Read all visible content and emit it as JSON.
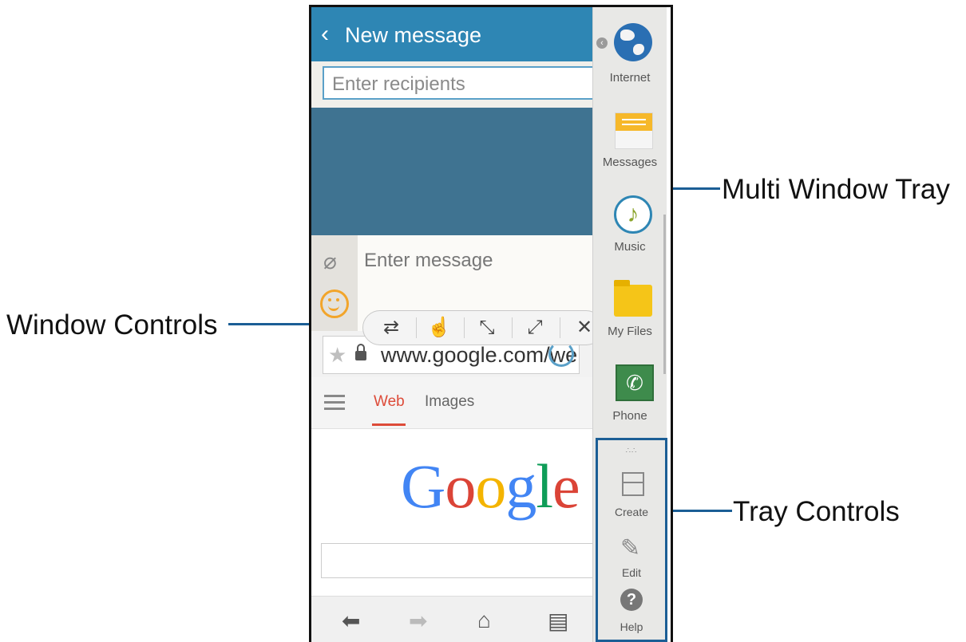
{
  "callouts": {
    "multi_window_tray": "Multi Window Tray",
    "window_controls": "Window Controls",
    "tray_controls": "Tray Controls"
  },
  "messages": {
    "back_icon": "‹",
    "title": "New message",
    "recipients_placeholder": "Enter recipients",
    "message_placeholder": "Enter message"
  },
  "browser": {
    "url": "www.google.com/we",
    "tabs": {
      "web": "Web",
      "images": "Images"
    },
    "logo": {
      "G": "G",
      "o1": "o",
      "o2": "o",
      "g": "g",
      "l": "l",
      "e": "e"
    }
  },
  "tray": {
    "apps": [
      {
        "label": "Internet"
      },
      {
        "label": "Messages"
      },
      {
        "label": "Music"
      },
      {
        "label": "My Files"
      },
      {
        "label": "Phone"
      }
    ],
    "controls": [
      {
        "label": "Create"
      },
      {
        "label": "Edit"
      },
      {
        "label": "Help"
      }
    ]
  },
  "colors": {
    "header_blue": "#2e86b4",
    "callout_line": "#1b5e95",
    "google_blue": "#4285f4",
    "google_red": "#db4437",
    "google_yellow": "#f4b400",
    "google_green": "#0f9d58"
  }
}
